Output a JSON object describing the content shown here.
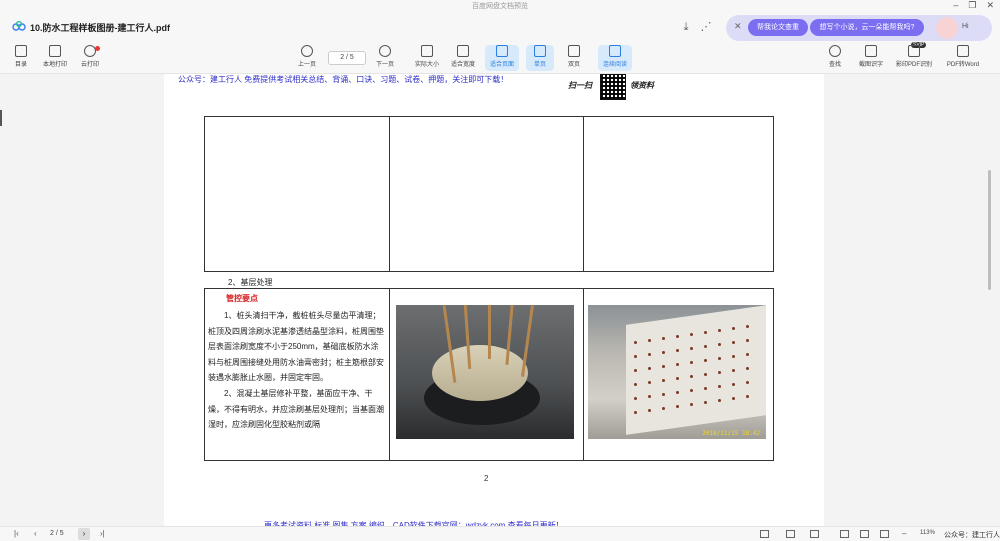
{
  "window": {
    "caption": "百度网盘文档预览",
    "doc_title": "10.防水工程样板图册-建工行人.pdf"
  },
  "ai_panel": {
    "chip_one": "帮我论文查重",
    "chip_two": "想写个小说，云一朵能帮我吗?",
    "hi": "Hi"
  },
  "toolbar": {
    "left": [
      {
        "label": "目录"
      },
      {
        "label": "本地打印"
      },
      {
        "label": "云打印"
      }
    ],
    "prev": "上一页",
    "page_indicator": "2 / 5",
    "next": "下一页",
    "actual_size": "实际大小",
    "fit_width": "适合宽度",
    "fit_page": "适合页面",
    "single": "单页",
    "double": "双页",
    "continuous": "连续阅读",
    "right": [
      {
        "label": "查找"
      },
      {
        "label": "截图识字"
      },
      {
        "label": "影印PDF识别"
      },
      {
        "label": "PDF转Word"
      }
    ],
    "svip": "SVIP"
  },
  "page": {
    "publisher_line": "公众号：建工行人 免费提供考试相关总结、背诵、口诀、习题、试卷、押题，关注即可下载！",
    "scan_left": "扫一扫",
    "scan_right": "领资料",
    "section_title": "2、基层处理",
    "control_title": "管控要点",
    "paragraph_1": "1、桩头清扫干净，截桩桩头尽量齿平清理；桩顶及四周涂刷水泥基渗透结晶型涂料，桩周围垫层表面涂刷宽度不小于250mm，基础底板防水涂料与桩周围接缝处用防水油膏密封；桩主筋根部安装遇水膨胀止水圈，并固定牢固。",
    "paragraph_2": "2、混凝土基层修补平整，基面应干净、干燥，不得有明水，并应涂刷基层处理剂；当基面潮湿时，应涂刷固化型胶粘剂或隔",
    "photo_stamp": "2018/11/15 18:42",
    "page_number": "2",
    "footer_line": "更多考试资料 标准 图集 方案 编织、CAD软件下载官网：wdzyk.com 查看每日更新！"
  },
  "statusbar": {
    "page": "2 / 5",
    "zoom": "113%",
    "watermark": "公众号：建工行人"
  }
}
